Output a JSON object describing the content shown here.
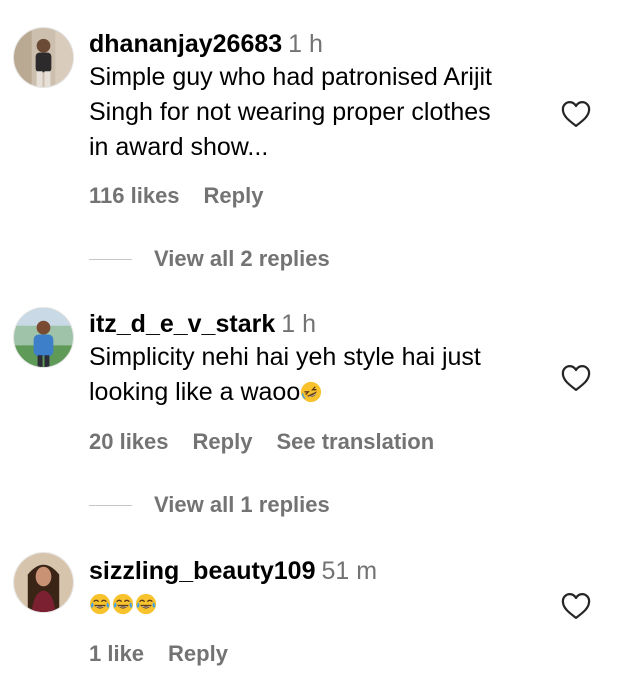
{
  "comments": [
    {
      "username": "dhananjay26683",
      "time": "1 h",
      "text_lines": [
        "Simple guy who had patronised Arijit",
        "Singh for not wearing proper clothes",
        "in award show..."
      ],
      "likes": "116 likes",
      "reply_label": "Reply",
      "view_replies": "View all 2 replies",
      "avatar_icon": "user-avatar-icon"
    },
    {
      "username": "itz_d_e_v_stark",
      "time": "1 h",
      "text_lines": [
        "Simplicity nehi hai yeh style hai just",
        "looking like a waoo"
      ],
      "text_emoji": "rolling-on-floor-laughing",
      "likes": "20 likes",
      "reply_label": "Reply",
      "translate_label": "See translation",
      "view_replies": "View all 1 replies",
      "avatar_icon": "user-avatar-icon"
    },
    {
      "username": "sizzling_beauty109",
      "time": "51 m",
      "text_emoji": [
        "face-with-tears-of-joy",
        "face-with-tears-of-joy",
        "face-with-tears-of-joy"
      ],
      "likes": "1 like",
      "reply_label": "Reply",
      "avatar_icon": "user-avatar-icon"
    }
  ],
  "colors": {
    "primary_text": "#000000",
    "secondary_text": "#737373",
    "divider": "#c7c7c7",
    "emoji_yellow": "#f7c22c"
  },
  "icons": {
    "like": "heart-outline-icon"
  }
}
